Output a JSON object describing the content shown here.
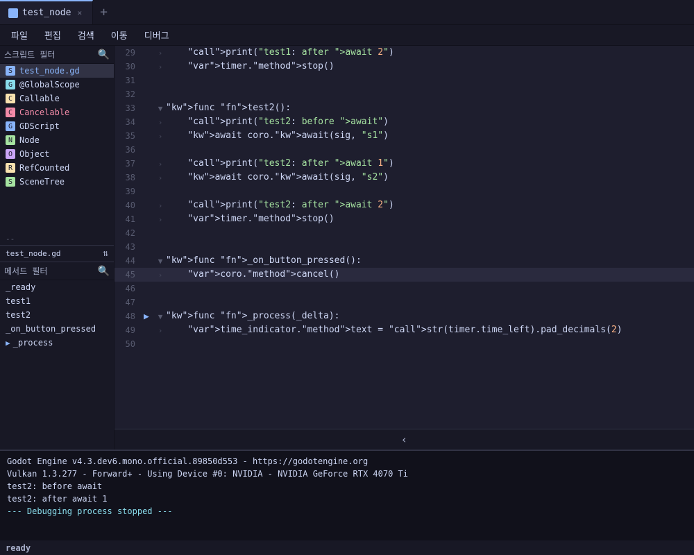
{
  "tabs": [
    {
      "label": "test_node",
      "active": true
    }
  ],
  "menu": {
    "items": [
      "파일",
      "편집",
      "검색",
      "이동",
      "디버그"
    ]
  },
  "sidebar": {
    "filter_label": "스크립트 필터",
    "items": [
      {
        "name": "test_node.gd",
        "type": "script",
        "active": true
      },
      {
        "name": "@GlobalScope",
        "type": "global"
      },
      {
        "name": "Callable",
        "type": "class"
      },
      {
        "name": "Cancelable",
        "type": "class",
        "highlighted": true
      },
      {
        "name": "GDScript",
        "type": "class"
      },
      {
        "name": "Node",
        "type": "class"
      },
      {
        "name": "Object",
        "type": "class"
      },
      {
        "name": "RefCounted",
        "type": "class"
      },
      {
        "name": "SceneTree",
        "type": "class"
      }
    ],
    "filename": "test_node.gd",
    "method_filter_label": "메서드 필터",
    "methods": [
      {
        "name": "_ready",
        "current": false
      },
      {
        "name": "test1",
        "current": false
      },
      {
        "name": "test2",
        "current": false
      },
      {
        "name": "_on_button_pressed",
        "current": false
      },
      {
        "name": "_process",
        "current": true
      }
    ]
  },
  "code": {
    "lines": [
      {
        "num": 29,
        "fold": false,
        "bp": false,
        "content": "    print(\"test1: after await 2\")",
        "highlighted": false
      },
      {
        "num": 30,
        "fold": false,
        "bp": false,
        "content": "    timer.stop()",
        "highlighted": false
      },
      {
        "num": 31,
        "fold": false,
        "bp": false,
        "content": "",
        "highlighted": false
      },
      {
        "num": 32,
        "fold": false,
        "bp": false,
        "content": "",
        "highlighted": false
      },
      {
        "num": 33,
        "fold": true,
        "bp": false,
        "content": "func test2():",
        "highlighted": false
      },
      {
        "num": 34,
        "fold": false,
        "bp": false,
        "content": "    print(\"test2: before await\")",
        "highlighted": false
      },
      {
        "num": 35,
        "fold": false,
        "bp": false,
        "content": "    await coro.await(sig, \"s1\")",
        "highlighted": false
      },
      {
        "num": 36,
        "fold": false,
        "bp": false,
        "content": "",
        "highlighted": false
      },
      {
        "num": 37,
        "fold": false,
        "bp": false,
        "content": "    print(\"test2: after await 1\")",
        "highlighted": false
      },
      {
        "num": 38,
        "fold": false,
        "bp": false,
        "content": "    await coro.await(sig, \"s2\")",
        "highlighted": false
      },
      {
        "num": 39,
        "fold": false,
        "bp": false,
        "content": "",
        "highlighted": false
      },
      {
        "num": 40,
        "fold": false,
        "bp": false,
        "content": "    print(\"test2: after await 2\")",
        "highlighted": false
      },
      {
        "num": 41,
        "fold": false,
        "bp": false,
        "content": "    timer.stop()",
        "highlighted": false
      },
      {
        "num": 42,
        "fold": false,
        "bp": false,
        "content": "",
        "highlighted": false
      },
      {
        "num": 43,
        "fold": false,
        "bp": false,
        "content": "",
        "highlighted": false
      },
      {
        "num": 44,
        "fold": true,
        "bp": false,
        "content": "func _on_button_pressed():",
        "highlighted": false
      },
      {
        "num": 45,
        "fold": false,
        "bp": false,
        "content": "    coro.cancel()",
        "highlighted": true
      },
      {
        "num": 46,
        "fold": false,
        "bp": false,
        "content": "",
        "highlighted": false
      },
      {
        "num": 47,
        "fold": false,
        "bp": false,
        "content": "",
        "highlighted": false
      },
      {
        "num": 48,
        "fold": true,
        "bp": true,
        "content": "func _process(_delta):",
        "highlighted": false
      },
      {
        "num": 49,
        "fold": false,
        "bp": false,
        "content": "    time_indicator.text = str(timer.time_left).pad_decimals(2)",
        "highlighted": false
      },
      {
        "num": 50,
        "fold": false,
        "bp": false,
        "content": "",
        "highlighted": false
      }
    ]
  },
  "output": {
    "lines": [
      {
        "text": "Godot Engine v4.3.dev6.mono.official.89850d553 - https://godotengine.org",
        "type": "normal"
      },
      {
        "text": "Vulkan 1.3.277 - Forward+ - Using Device #0: NVIDIA - NVIDIA GeForce RTX 4070 Ti",
        "type": "normal"
      },
      {
        "text": "",
        "type": "normal"
      },
      {
        "text": "test2: before await",
        "type": "normal"
      },
      {
        "text": "test2: after await 1",
        "type": "normal"
      },
      {
        "text": "--- Debugging process stopped ---",
        "type": "debug"
      }
    ]
  },
  "status": {
    "ready_label": "ready"
  }
}
